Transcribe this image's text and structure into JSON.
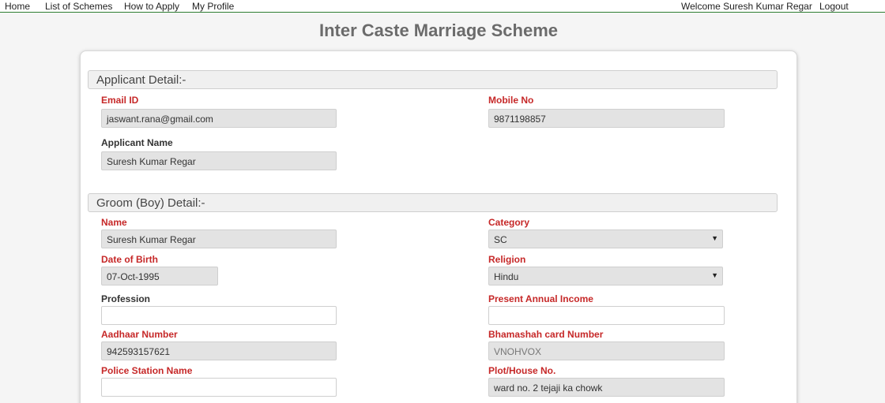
{
  "nav": {
    "home": "Home",
    "schemes": "List of Schemes",
    "how_to_apply": "How to Apply",
    "profile": "My Profile",
    "welcome": "Welcome Suresh Kumar Regar",
    "logout": "Logout"
  },
  "page_title": "Inter Caste Marriage Scheme",
  "applicant": {
    "header": "Applicant Detail:-",
    "email_label": "Email ID",
    "email_value": "jaswant.rana@gmail.com",
    "mobile_label": "Mobile No",
    "mobile_value": "9871198857",
    "name_label": "Applicant Name",
    "name_value": "Suresh Kumar Regar"
  },
  "groom": {
    "header": "Groom (Boy) Detail:-",
    "name_label": "Name",
    "name_value": "Suresh Kumar Regar",
    "category_label": "Category",
    "category_value": "SC",
    "dob_label": "Date of Birth",
    "dob_value": "07-Oct-1995",
    "religion_label": "Religion",
    "religion_value": "Hindu",
    "profession_label": "Profession",
    "profession_value": "",
    "income_label": "Present Annual Income",
    "income_value": "",
    "aadhaar_label": "Aadhaar Number",
    "aadhaar_value": "942593157621",
    "bhamashah_label": "Bhamashah card Number",
    "bhamashah_value": "VNOHVOX",
    "police_label": "Police Station Name",
    "police_value": "",
    "plot_label": "Plot/House No.",
    "plot_value": "ward no. 2 tejaji ka chowk"
  },
  "icons": {
    "dropdown": "chevron-down-icon"
  }
}
